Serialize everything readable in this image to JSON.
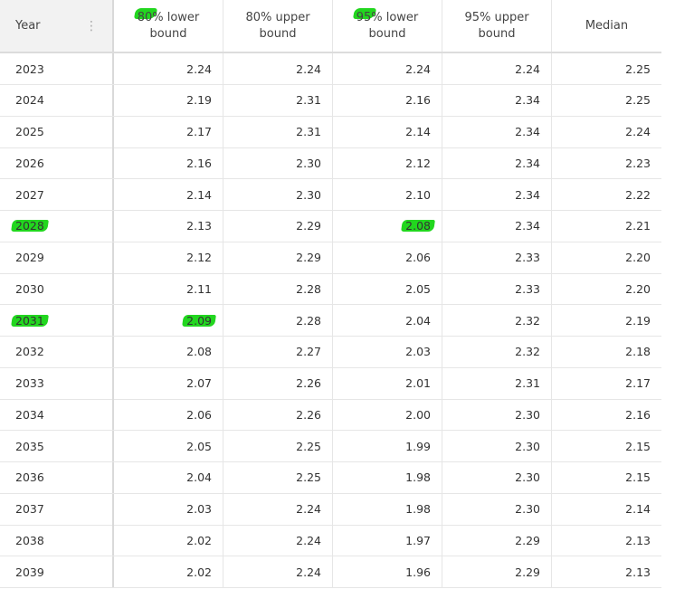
{
  "table": {
    "columns": [
      "Year",
      "80% lower\nbound",
      "80% upper\nbound",
      "95% lower\nbound",
      "95% upper\nbound",
      "Median"
    ],
    "header_highlight": [
      false,
      true,
      false,
      true,
      false,
      false
    ],
    "rows": [
      {
        "cells": [
          "2023",
          "2.24",
          "2.24",
          "2.24",
          "2.24",
          "2.25"
        ],
        "highlight": [
          false,
          false,
          false,
          false,
          false,
          false
        ]
      },
      {
        "cells": [
          "2024",
          "2.19",
          "2.31",
          "2.16",
          "2.34",
          "2.25"
        ],
        "highlight": [
          false,
          false,
          false,
          false,
          false,
          false
        ]
      },
      {
        "cells": [
          "2025",
          "2.17",
          "2.31",
          "2.14",
          "2.34",
          "2.24"
        ],
        "highlight": [
          false,
          false,
          false,
          false,
          false,
          false
        ]
      },
      {
        "cells": [
          "2026",
          "2.16",
          "2.30",
          "2.12",
          "2.34",
          "2.23"
        ],
        "highlight": [
          false,
          false,
          false,
          false,
          false,
          false
        ]
      },
      {
        "cells": [
          "2027",
          "2.14",
          "2.30",
          "2.10",
          "2.34",
          "2.22"
        ],
        "highlight": [
          false,
          false,
          false,
          false,
          false,
          false
        ]
      },
      {
        "cells": [
          "2028",
          "2.13",
          "2.29",
          "2.08",
          "2.34",
          "2.21"
        ],
        "highlight": [
          true,
          false,
          false,
          true,
          false,
          false
        ]
      },
      {
        "cells": [
          "2029",
          "2.12",
          "2.29",
          "2.06",
          "2.33",
          "2.20"
        ],
        "highlight": [
          false,
          false,
          false,
          false,
          false,
          false
        ]
      },
      {
        "cells": [
          "2030",
          "2.11",
          "2.28",
          "2.05",
          "2.33",
          "2.20"
        ],
        "highlight": [
          false,
          false,
          false,
          false,
          false,
          false
        ]
      },
      {
        "cells": [
          "2031",
          "2.09",
          "2.28",
          "2.04",
          "2.32",
          "2.19"
        ],
        "highlight": [
          true,
          true,
          false,
          false,
          false,
          false
        ]
      },
      {
        "cells": [
          "2032",
          "2.08",
          "2.27",
          "2.03",
          "2.32",
          "2.18"
        ],
        "highlight": [
          false,
          false,
          false,
          false,
          false,
          false
        ]
      },
      {
        "cells": [
          "2033",
          "2.07",
          "2.26",
          "2.01",
          "2.31",
          "2.17"
        ],
        "highlight": [
          false,
          false,
          false,
          false,
          false,
          false
        ]
      },
      {
        "cells": [
          "2034",
          "2.06",
          "2.26",
          "2.00",
          "2.30",
          "2.16"
        ],
        "highlight": [
          false,
          false,
          false,
          false,
          false,
          false
        ]
      },
      {
        "cells": [
          "2035",
          "2.05",
          "2.25",
          "1.99",
          "2.30",
          "2.15"
        ],
        "highlight": [
          false,
          false,
          false,
          false,
          false,
          false
        ]
      },
      {
        "cells": [
          "2036",
          "2.04",
          "2.25",
          "1.98",
          "2.30",
          "2.15"
        ],
        "highlight": [
          false,
          false,
          false,
          false,
          false,
          false
        ]
      },
      {
        "cells": [
          "2037",
          "2.03",
          "2.24",
          "1.98",
          "2.30",
          "2.14"
        ],
        "highlight": [
          false,
          false,
          false,
          false,
          false,
          false
        ]
      },
      {
        "cells": [
          "2038",
          "2.02",
          "2.24",
          "1.97",
          "2.29",
          "2.13"
        ],
        "highlight": [
          false,
          false,
          false,
          false,
          false,
          false
        ]
      },
      {
        "cells": [
          "2039",
          "2.02",
          "2.24",
          "1.96",
          "2.29",
          "2.13"
        ],
        "highlight": [
          false,
          false,
          false,
          false,
          false,
          false
        ]
      }
    ],
    "header_menu_icon": "kebab-menu-icon",
    "highlight_color": "#22d61f"
  }
}
